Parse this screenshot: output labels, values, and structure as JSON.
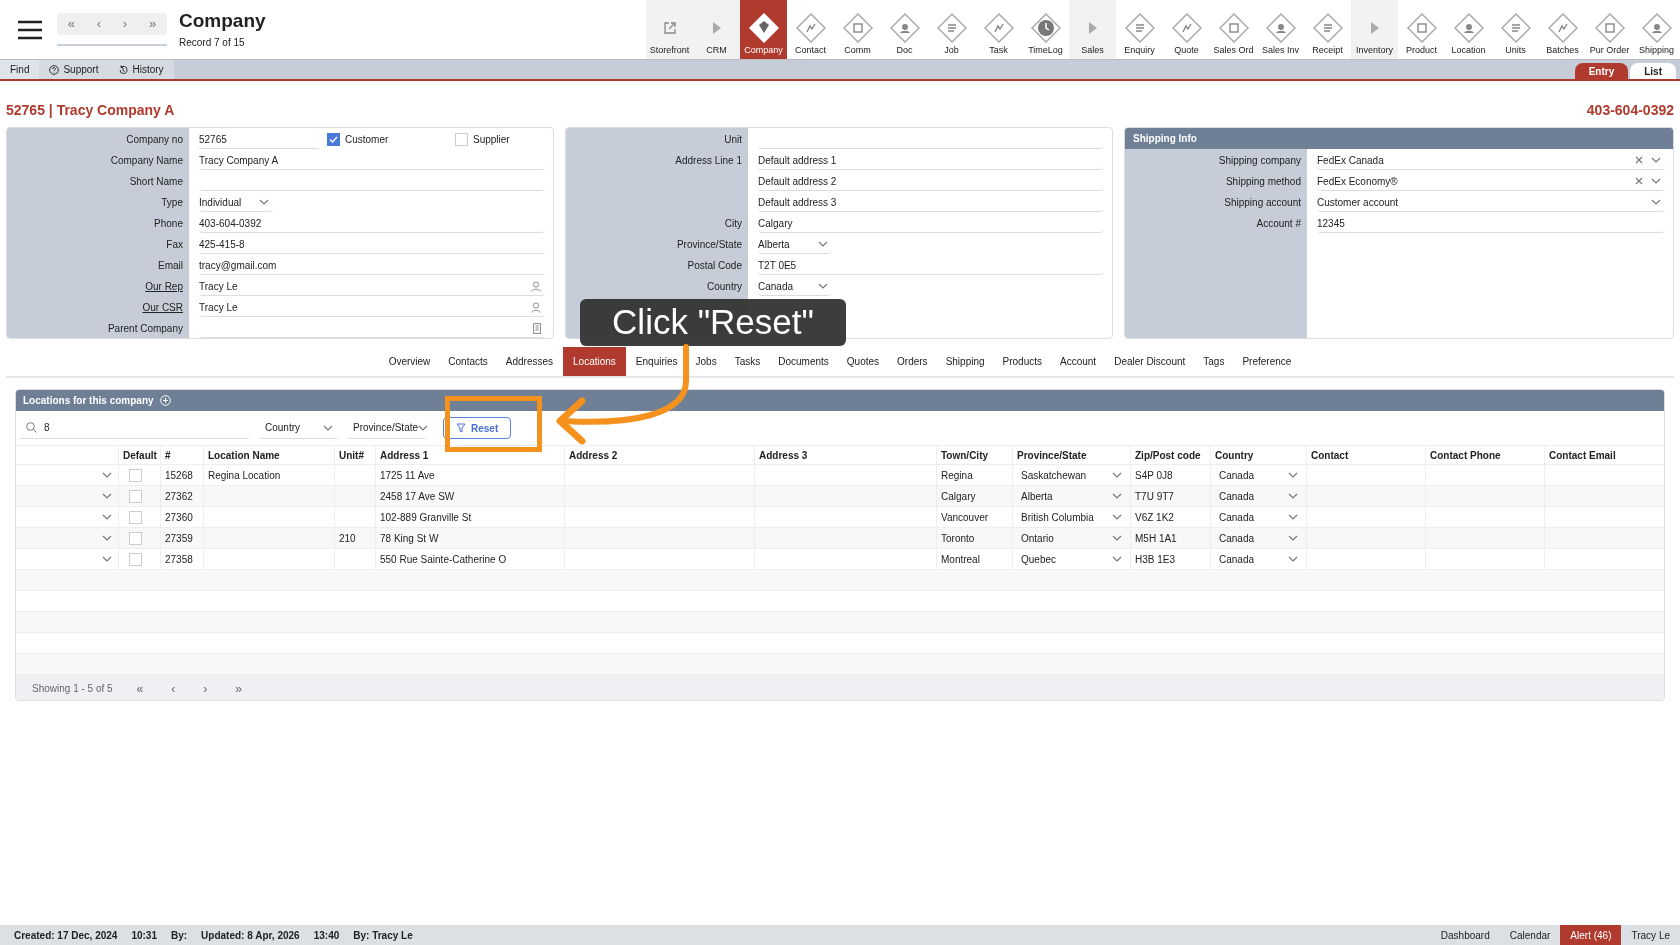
{
  "header": {
    "title": "Company",
    "subtitle": "Record 7 of 15",
    "nav": [
      "«",
      "‹",
      "›",
      "»"
    ]
  },
  "toolbar": [
    {
      "label": "Storefront",
      "kind": "link",
      "selected": false
    },
    {
      "label": "CRM",
      "kind": "section",
      "selected": false
    },
    {
      "label": "Company",
      "kind": "module",
      "selected": true
    },
    {
      "label": "Contact",
      "kind": "module",
      "selected": false
    },
    {
      "label": "Comm",
      "kind": "module",
      "selected": false
    },
    {
      "label": "Doc",
      "kind": "module",
      "selected": false
    },
    {
      "label": "Job",
      "kind": "module",
      "selected": false
    },
    {
      "label": "Task",
      "kind": "module",
      "selected": false
    },
    {
      "label": "TimeLog",
      "kind": "clock",
      "selected": false
    },
    {
      "label": "Sales",
      "kind": "section",
      "selected": false
    },
    {
      "label": "Enquiry",
      "kind": "module",
      "selected": false
    },
    {
      "label": "Quote",
      "kind": "module",
      "selected": false
    },
    {
      "label": "Sales Ord",
      "kind": "module",
      "selected": false
    },
    {
      "label": "Sales Inv",
      "kind": "module",
      "selected": false
    },
    {
      "label": "Receipt",
      "kind": "module",
      "selected": false
    },
    {
      "label": "Inventory",
      "kind": "section",
      "selected": false
    },
    {
      "label": "Product",
      "kind": "module",
      "selected": false
    },
    {
      "label": "Location",
      "kind": "module",
      "selected": false
    },
    {
      "label": "Units",
      "kind": "module",
      "selected": false
    },
    {
      "label": "Batches",
      "kind": "module",
      "selected": false
    },
    {
      "label": "Pur Order",
      "kind": "module",
      "selected": false
    },
    {
      "label": "Shipping",
      "kind": "module",
      "selected": false
    }
  ],
  "action_bar": {
    "buttons": [
      {
        "label": "Find",
        "kind": "plain"
      },
      {
        "label": "Support",
        "kind": "help"
      },
      {
        "label": "History",
        "kind": "history"
      }
    ],
    "views": [
      {
        "label": "Entry",
        "selected": true
      },
      {
        "label": "List",
        "selected": false
      }
    ]
  },
  "record": {
    "title": "52765 | Tracy Company A",
    "phone": "403-604-0392"
  },
  "company": {
    "rows": [
      {
        "label": "Company no",
        "value": "52765",
        "kind": "id",
        "checks": [
          {
            "label": "Customer",
            "checked": true
          },
          {
            "label": "Supplier",
            "checked": false
          }
        ]
      },
      {
        "label": "Company Name",
        "value": "Tracy Company A",
        "kind": "text"
      },
      {
        "label": "Short Name",
        "kind": "text"
      },
      {
        "label": "Type",
        "value": "Individual",
        "kind": "select"
      },
      {
        "label": "Phone",
        "value": "403-604-0392",
        "kind": "text"
      },
      {
        "label": "Fax",
        "value": "425-415-8",
        "kind": "text"
      },
      {
        "label": "Email",
        "value": "tracy@gmail.com",
        "kind": "text"
      },
      {
        "label": "Our Rep",
        "value": "Tracy Le",
        "kind": "person",
        "link": true
      },
      {
        "label": "Our CSR",
        "value": "Tracy Le",
        "kind": "person",
        "link": true
      },
      {
        "label": "Parent Company",
        "kind": "building"
      }
    ]
  },
  "address": {
    "rows": [
      {
        "label": "Unit",
        "kind": "text"
      },
      {
        "label": "Address Line 1",
        "value": "Default address 1",
        "kind": "text"
      },
      {
        "value": "Default address 2",
        "kind": "text"
      },
      {
        "value": "Default address 3",
        "kind": "text"
      },
      {
        "label": "City",
        "value": "Calgary",
        "kind": "text"
      },
      {
        "label": "Province/State",
        "value": "Alberta",
        "kind": "select"
      },
      {
        "label": "Postal Code",
        "value": "T2T 0E5",
        "kind": "text"
      },
      {
        "label": "Country",
        "value": "Canada",
        "kind": "select"
      }
    ]
  },
  "shipping": {
    "title": "Shipping Info",
    "rows": [
      {
        "label": "Shipping company",
        "value": "FedEx Canada",
        "kind": "clearable"
      },
      {
        "label": "Shipping method",
        "value": "FedEx Economy®",
        "kind": "clearable"
      },
      {
        "label": "Shipping account",
        "value": "Customer account",
        "kind": "dropdown"
      },
      {
        "label": "Account #",
        "value": "12345",
        "kind": "text"
      }
    ]
  },
  "tabs": [
    {
      "label": "Overview",
      "selected": false
    },
    {
      "label": "Contacts",
      "selected": false
    },
    {
      "label": "Addresses",
      "selected": false
    },
    {
      "label": "Locations",
      "selected": true
    },
    {
      "label": "Enquiries",
      "selected": false
    },
    {
      "label": "Jobs",
      "selected": false
    },
    {
      "label": "Tasks",
      "selected": false
    },
    {
      "label": "Documents",
      "selected": false
    },
    {
      "label": "Quotes",
      "selected": false
    },
    {
      "label": "Orders",
      "selected": false
    },
    {
      "label": "Shipping",
      "selected": false
    },
    {
      "label": "Products",
      "selected": false
    },
    {
      "label": "Account",
      "selected": false
    },
    {
      "label": "Dealer Discount",
      "selected": false
    },
    {
      "label": "Tags",
      "selected": false
    },
    {
      "label": "Preference",
      "selected": false
    }
  ],
  "locations": {
    "title": "Locations for this company",
    "search": "8",
    "filters": [
      "Country",
      "Province/State"
    ],
    "reset": "Reset",
    "columns": [
      {
        "label": "Default",
        "kind": "checkbox"
      },
      {
        "label": "#",
        "kind": "text"
      },
      {
        "label": "Location Name",
        "kind": "text"
      },
      {
        "label": "Unit#",
        "kind": "text"
      },
      {
        "label": "Address 1",
        "kind": "text"
      },
      {
        "label": "Address 2",
        "kind": "text"
      },
      {
        "label": "Address 3",
        "kind": "text"
      },
      {
        "label": "Town/City",
        "kind": "text"
      },
      {
        "label": "Province/State",
        "kind": "select"
      },
      {
        "label": "Zip/Post code",
        "kind": "text"
      },
      {
        "label": "Country",
        "kind": "select"
      },
      {
        "label": "Contact",
        "kind": "text"
      },
      {
        "label": "Contact Phone",
        "kind": "text"
      },
      {
        "label": "Contact Email",
        "kind": "text"
      }
    ],
    "rows": [
      {
        "default": false,
        "id": "15268",
        "name": "Regina Location",
        "address_1": "1725 11 Ave",
        "town": "Regina",
        "province": "Saskatchewan",
        "zip": "S4P 0J8",
        "country": "Canada"
      },
      {
        "default": false,
        "id": "27362",
        "address_1": "2458 17 Ave SW",
        "town": "Calgary",
        "province": "Alberta",
        "zip": "T7U 9T7",
        "country": "Canada"
      },
      {
        "default": false,
        "id": "27360",
        "address_1": "102-889 Granville St",
        "town": "Vancouver",
        "province": "British Columbia",
        "zip": "V6Z 1K2",
        "country": "Canada"
      },
      {
        "default": false,
        "id": "27359",
        "unit": "210",
        "address_1": "78 King St W",
        "town": "Toronto",
        "province": "Ontario",
        "zip": "M5H 1A1",
        "country": "Canada"
      },
      {
        "default": false,
        "id": "27358",
        "address_1": "550 Rue Sainte-Catherine O",
        "town": "Montreal",
        "province": "Quebec",
        "zip": "H3B 1E3",
        "country": "Canada"
      }
    ],
    "footer": "Showing 1 - 5 of 5",
    "pager": [
      "«",
      "‹",
      "›",
      "»"
    ]
  },
  "annotation": {
    "callout": "Click \"Reset\""
  },
  "status_bar": {
    "left": [
      "Created: 17 Dec, 2024",
      "10:31",
      "By:",
      "Updated: 8 Apr, 2026",
      "13:40",
      "By: Tracy Le"
    ],
    "right": [
      {
        "label": "Dashboard",
        "alert": false
      },
      {
        "label": "Calendar",
        "alert": false
      },
      {
        "label": "Alert (46)",
        "alert": true
      },
      {
        "label": "Tracy Le",
        "alert": false
      }
    ]
  }
}
